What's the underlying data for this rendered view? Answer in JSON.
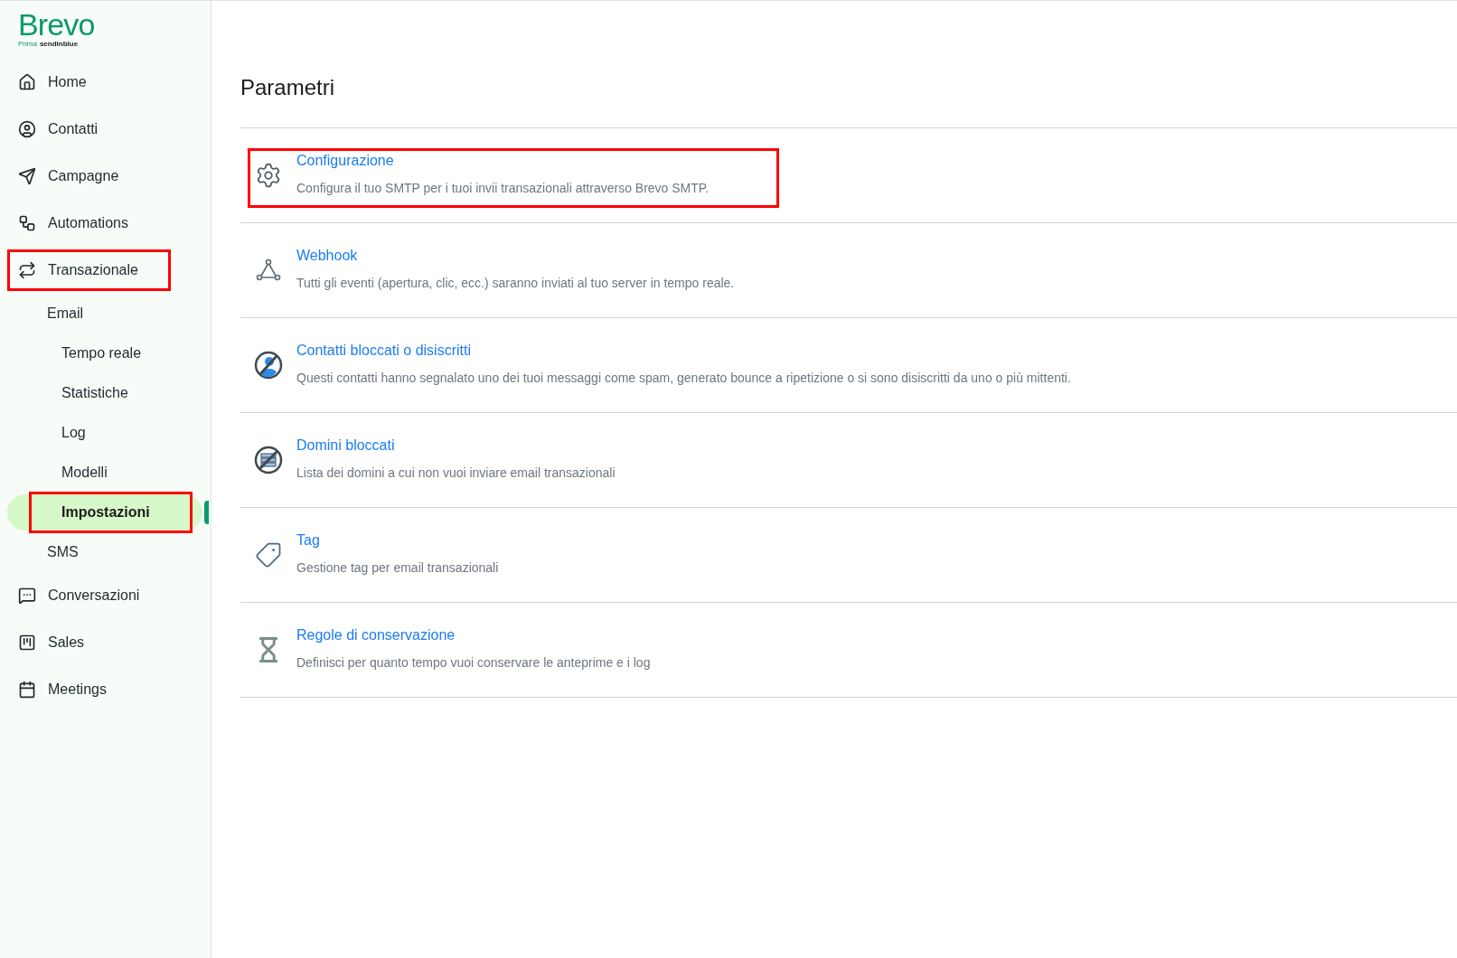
{
  "logo": {
    "brand": "Brevo",
    "prefix": "Prima",
    "suffix": "sendinblue"
  },
  "sidebar": {
    "items": [
      {
        "label": "Home",
        "selected": false,
        "annotated": false
      },
      {
        "label": "Contatti",
        "selected": false,
        "annotated": false
      },
      {
        "label": "Campagne",
        "selected": false,
        "annotated": false
      },
      {
        "label": "Automations",
        "selected": false,
        "annotated": false
      },
      {
        "label": "Transazionale",
        "selected": false,
        "annotated": true,
        "children": [
          {
            "label": "Email",
            "selected": false,
            "annotated": false,
            "children": [
              {
                "label": "Tempo reale",
                "selected": false,
                "annotated": false
              },
              {
                "label": "Statistiche",
                "selected": false,
                "annotated": false
              },
              {
                "label": "Log",
                "selected": false,
                "annotated": false
              },
              {
                "label": "Modelli",
                "selected": false,
                "annotated": false
              },
              {
                "label": "Impostazioni",
                "selected": true,
                "annotated": true
              }
            ]
          },
          {
            "label": "SMS",
            "selected": false,
            "annotated": false
          }
        ]
      },
      {
        "label": "Conversazioni",
        "selected": false,
        "annotated": false
      },
      {
        "label": "Sales",
        "selected": false,
        "annotated": false
      },
      {
        "label": "Meetings",
        "selected": false,
        "annotated": false
      }
    ]
  },
  "page_title": "Parametri",
  "settings": [
    {
      "title": "Configurazione",
      "description": "Configura il tuo SMTP per i tuoi invii transazionali attraverso Brevo SMTP.",
      "annotated": true
    },
    {
      "title": "Webhook",
      "description": "Tutti gli eventi (apertura, clic, ecc.) saranno inviati al tuo server in tempo reale.",
      "annotated": false
    },
    {
      "title": "Contatti bloccati o disiscritti",
      "description": "Questi contatti hanno segnalato uno dei tuoi messaggi come spam, generato bounce a ripetizione o si sono disiscritti da uno o più mittenti.",
      "annotated": false
    },
    {
      "title": "Domini bloccati",
      "description": "Lista dei domini a cui non vuoi inviare email transazionali",
      "annotated": false
    },
    {
      "title": "Tag",
      "description": "Gestione tag per email transazionali",
      "annotated": false
    },
    {
      "title": "Regole di conservazione",
      "description": "Definisci per quanto tempo vuoi conservare le anteprime e i log",
      "annotated": false
    }
  ]
}
